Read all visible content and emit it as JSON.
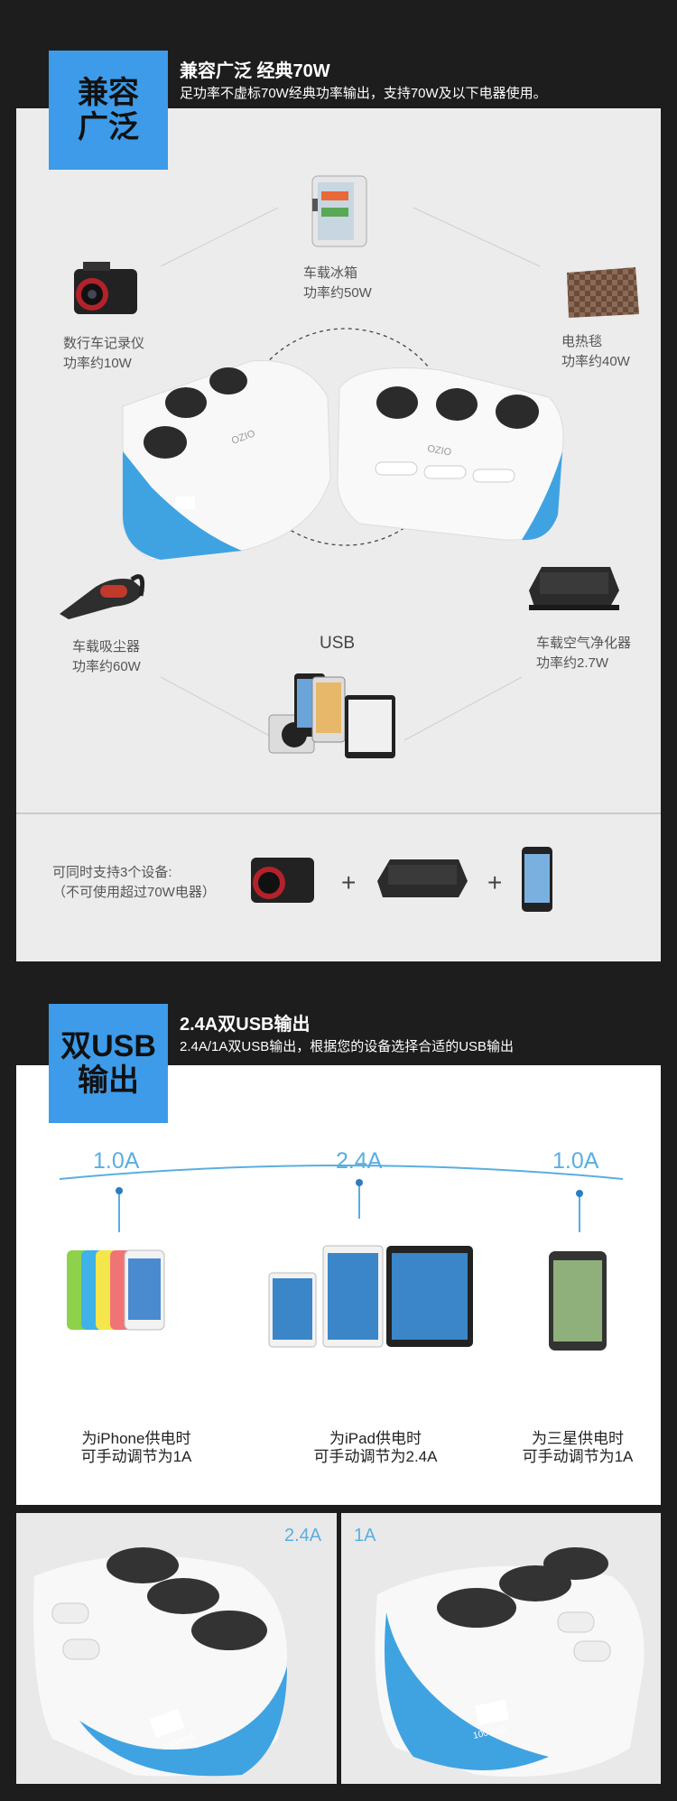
{
  "section1": {
    "badge_line1": "兼容",
    "badge_line2": "广泛",
    "title": "兼容广泛 经典70W",
    "subtitle": "足功率不虚标70W经典功率输出，支持70W及以下电器使用。",
    "devices": [
      {
        "name": "车载冰箱",
        "power": "功率约50W",
        "icon": "fridge-icon"
      },
      {
        "name": "数行车记录仪",
        "power": "功率约10W",
        "icon": "dashcam-icon"
      },
      {
        "name": "电热毯",
        "power": "功率约40W",
        "icon": "blanket-icon"
      },
      {
        "name": "车载吸尘器",
        "power": "功率约60W",
        "icon": "vacuum-icon"
      },
      {
        "name": "车载空气净化器",
        "power": "功率约2.7W",
        "icon": "purifier-icon"
      }
    ],
    "usb_label": "USB",
    "brand": "OZIO",
    "support_line1": "可同时支持3个设备:",
    "support_line2": "（不可使用超过70W电器）",
    "plus": "+"
  },
  "section2": {
    "badge_line1": "双USB",
    "badge_line2": "输出",
    "title": "2.4A双USB输出",
    "subtitle": "2.4A/1A双USB输出，根据您的设备选择合适的USB输出",
    "currents": [
      "1.0A",
      "2.4A",
      "1.0A"
    ],
    "captions": [
      {
        "line1": "为iPhone供电时",
        "line2": "可手动调节为1A"
      },
      {
        "line1": "为iPad供电时",
        "line2": "可手动调节为2.4A"
      },
      {
        "line1": "为三星供电时",
        "line2": "可手动调节为1A"
      }
    ]
  },
  "section3": {
    "left_label": "2.4A",
    "right_label": "1A",
    "left_port": "2400mA",
    "right_port": "1000mA",
    "brand": "OZIO"
  },
  "colors": {
    "accent": "#3d9be9",
    "line": "#5aaee0",
    "background": "#1d1d1d"
  }
}
